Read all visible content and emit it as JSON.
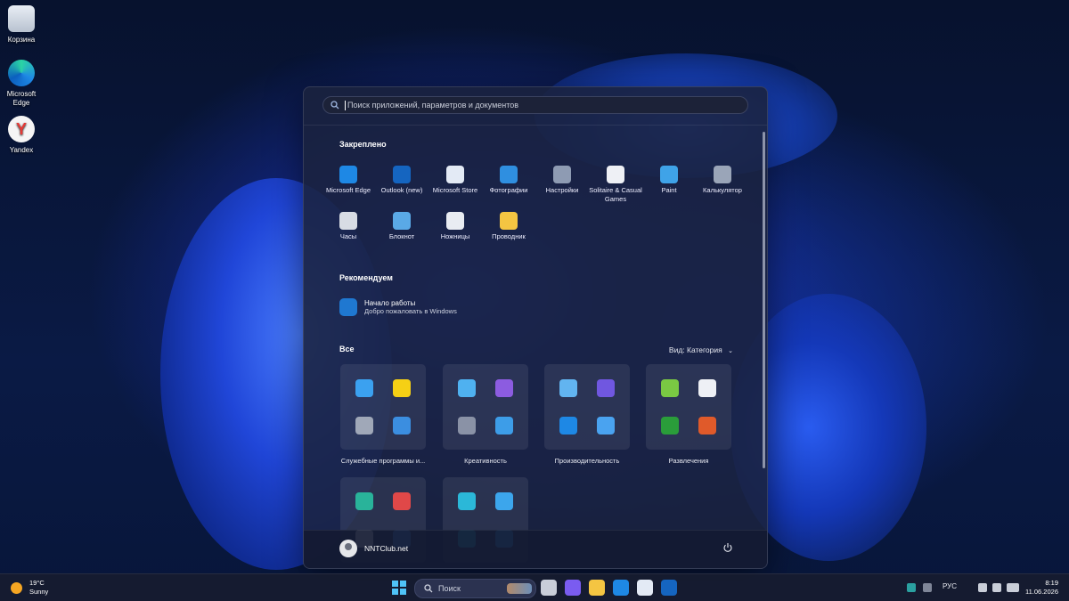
{
  "desktop": {
    "icons": [
      {
        "label": "Корзина",
        "icon": "recycle-bin-icon"
      },
      {
        "label": "Microsoft Edge",
        "icon": "edge-icon"
      },
      {
        "label": "Yandex",
        "icon": "yandex-icon"
      }
    ]
  },
  "start": {
    "search_placeholder": "Поиск приложений, параметров и документов",
    "pinned_title": "Закреплено",
    "pinned": [
      {
        "label": "Microsoft Edge",
        "icon": "edge-icon",
        "color": "#1e88e5"
      },
      {
        "label": "Outlook (new)",
        "icon": "outlook-icon",
        "color": "#1565c0"
      },
      {
        "label": "Microsoft Store",
        "icon": "store-icon",
        "color": "#e3eaf5"
      },
      {
        "label": "Фотографии",
        "icon": "photos-icon",
        "color": "#2f8fe0"
      },
      {
        "label": "Настройки",
        "icon": "gear-icon",
        "color": "#8e9bb3"
      },
      {
        "label": "Solitaire & Casual Games",
        "icon": "cards-icon",
        "color": "#eef0f5"
      },
      {
        "label": "Paint",
        "icon": "paint-icon",
        "color": "#3fa3e8"
      },
      {
        "label": "Калькулятор",
        "icon": "calculator-icon",
        "color": "#9aa5b8"
      },
      {
        "label": "Часы",
        "icon": "clock-icon",
        "color": "#d8dce4"
      },
      {
        "label": "Блокнот",
        "icon": "notepad-icon",
        "color": "#5aa9e6"
      },
      {
        "label": "Ножницы",
        "icon": "snipping-icon",
        "color": "#e9ecf2"
      },
      {
        "label": "Проводник",
        "icon": "folder-icon",
        "color": "#f4c542"
      }
    ],
    "recommended_title": "Рекомендуем",
    "recommended": {
      "title": "Начало работы",
      "subtitle": "Добро пожаловать в Windows",
      "icon": "get-started-icon"
    },
    "all_title": "Все",
    "view_label": "Вид: Категория",
    "categories": [
      {
        "label": "Служебные программы и...",
        "icons": [
          [
            "#3ba1f0",
            "#f5d015"
          ],
          [
            "#a0a8b8",
            "#3b8ee0"
          ]
        ]
      },
      {
        "label": "Креативность",
        "icons": [
          [
            "#4fb1f0",
            "#8c5ce0"
          ],
          [
            "#8a92a6",
            "#3d9de8"
          ]
        ]
      },
      {
        "label": "Производительность",
        "icons": [
          [
            "#62b4f0",
            "#7057e0"
          ],
          [
            "#1e88e5",
            "#4aa3f0"
          ]
        ]
      },
      {
        "label": "Развлечения",
        "icons": [
          [
            "#7ac943",
            "#eef0f5"
          ],
          [
            "#2a9d3a",
            "#e05a2a"
          ]
        ]
      },
      {
        "label": "",
        "icons": [
          [
            "#29b39a",
            "#e04848"
          ],
          [
            "#ffffff",
            "#4a9ee8"
          ]
        ]
      },
      {
        "label": "",
        "icons": [
          [
            "#2bb8d8",
            "#3ca6ec"
          ],
          [
            "#2bb8d8",
            "#3ca6ec"
          ]
        ]
      }
    ],
    "user_name": "NNTClub.net"
  },
  "taskbar": {
    "weather_temp": "19°C",
    "weather_desc": "Sunny",
    "search_label": "Поиск",
    "apps": [
      {
        "icon": "task-view-icon",
        "color": "#c9ced9"
      },
      {
        "icon": "copilot-icon",
        "color": "#7a5cf0"
      },
      {
        "icon": "file-explorer-icon",
        "color": "#f4c542"
      },
      {
        "icon": "edge-icon",
        "color": "#1e88e5"
      },
      {
        "icon": "store-icon",
        "color": "#e3eaf5"
      },
      {
        "icon": "outlook-icon",
        "color": "#1565c0"
      }
    ],
    "language": "РУС",
    "time": "8:19",
    "date": "11.06.2026"
  }
}
